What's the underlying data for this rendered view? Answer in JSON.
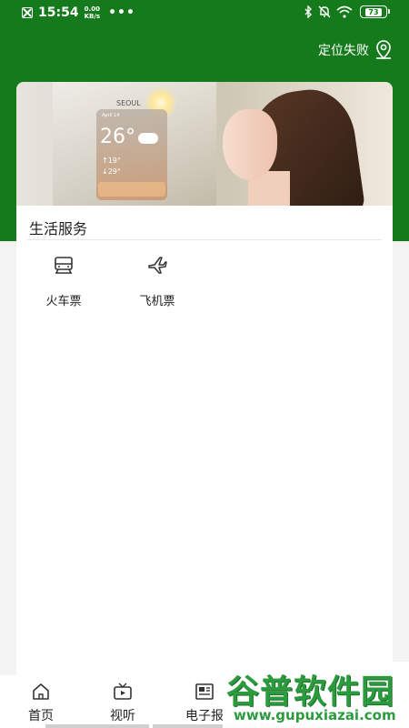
{
  "status_bar": {
    "time": "15:54",
    "net_speed_value": "0.00",
    "net_speed_unit": "KB/s",
    "more_dots": "•••",
    "battery": "73"
  },
  "header": {
    "location_text": "定位失败"
  },
  "banner": {
    "weather_city": "SEOUL",
    "weather_date": "April 14",
    "weather_temp": "26°",
    "weather_high": "↑19°",
    "weather_low": "↓29°"
  },
  "services": {
    "title": "生活服务",
    "items": [
      {
        "label": "火车票",
        "icon": "train-icon"
      },
      {
        "label": "飞机票",
        "icon": "airplane-icon"
      }
    ]
  },
  "tabbar": {
    "items": [
      {
        "label": "首页",
        "icon": "home-icon"
      },
      {
        "label": "视听",
        "icon": "tv-icon"
      },
      {
        "label": "电子报",
        "icon": "newspaper-icon"
      }
    ]
  },
  "watermark": {
    "logo": "谷普软件园",
    "url": "www.gupuxiazai.com"
  },
  "colors": {
    "brand_green": "#147a1b",
    "watermark_green": "#2c9b3e"
  }
}
